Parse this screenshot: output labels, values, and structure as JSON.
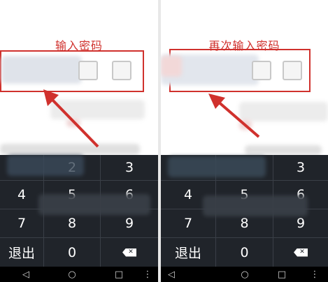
{
  "left": {
    "title": "输入密码",
    "keys": {
      "k3": "3",
      "k4": "4",
      "k5": "5",
      "k6": "6",
      "k7": "7",
      "k8": "8",
      "k9": "9",
      "k0": "0",
      "k2": "2",
      "exit": "退出"
    },
    "nav": {
      "back": "◁",
      "home": "○",
      "recent": "□",
      "more": "⋮"
    }
  },
  "right": {
    "title": "再次输入密码",
    "keys": {
      "k3": "3",
      "k4": "4",
      "k5": "5",
      "k6": "6",
      "k7": "7",
      "k8": "8",
      "k9": "9",
      "k0": "0",
      "exit": "退出"
    },
    "nav": {
      "back": "◁",
      "home": "○",
      "recent": "□",
      "more": "⋮"
    }
  },
  "colors": {
    "accent_red": "#d0312d",
    "keyboard_bg": "#20242a",
    "nav_bg": "#000000"
  },
  "icons": [
    "backspace-icon",
    "nav-back-icon",
    "nav-home-icon",
    "nav-recent-icon",
    "nav-more-icon",
    "annotation-arrow-icon"
  ]
}
